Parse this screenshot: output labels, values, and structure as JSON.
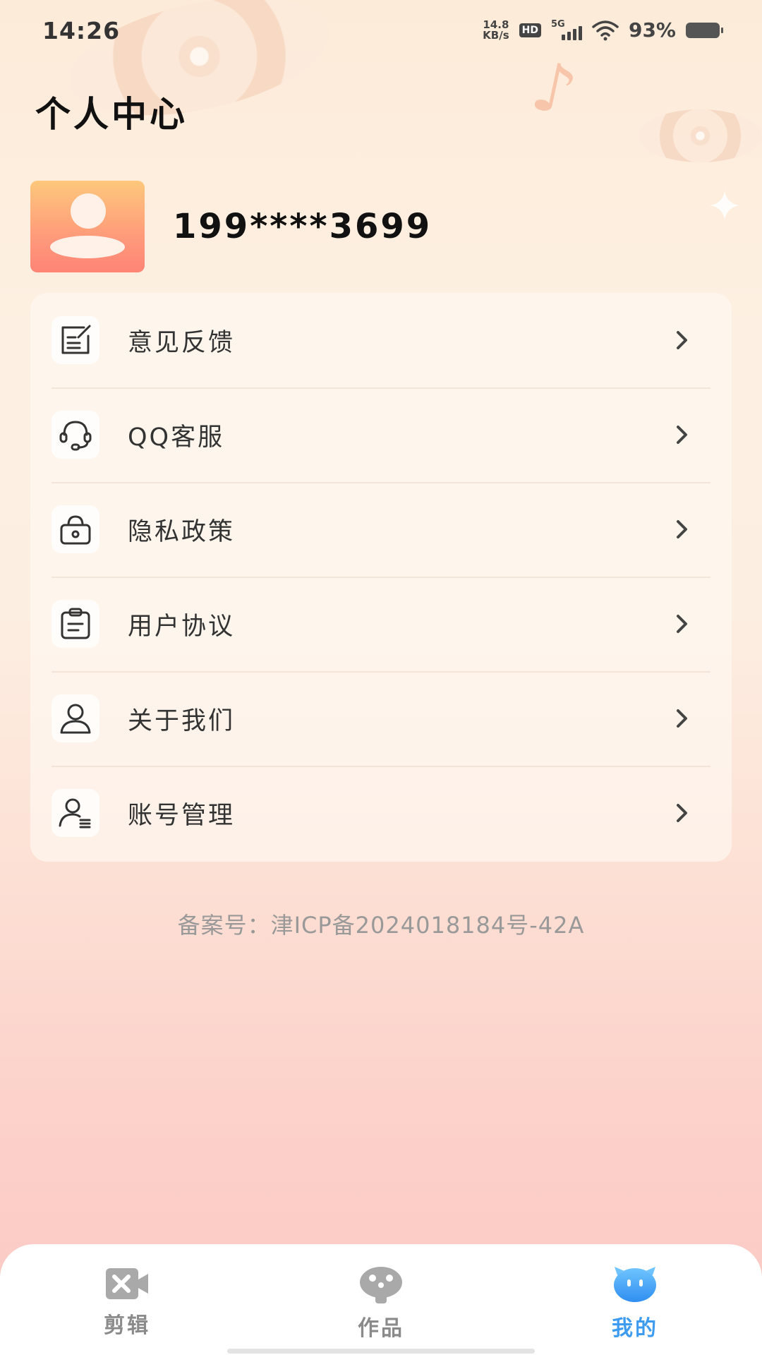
{
  "status_bar": {
    "time": "14:26",
    "net_speed_value": "14.8",
    "net_speed_unit": "KB/s",
    "hd_label": "HD",
    "network_type": "5G",
    "battery_percent": "93%"
  },
  "page": {
    "title": "个人中心"
  },
  "profile": {
    "username": "199****3699"
  },
  "menu": {
    "items": [
      {
        "label": "意见反馈",
        "icon": "feedback-icon"
      },
      {
        "label": "QQ客服",
        "icon": "headset-icon"
      },
      {
        "label": "隐私政策",
        "icon": "lock-icon"
      },
      {
        "label": "用户协议",
        "icon": "clipboard-icon"
      },
      {
        "label": "关于我们",
        "icon": "person-icon"
      },
      {
        "label": "账号管理",
        "icon": "account-manage-icon"
      }
    ]
  },
  "footer": {
    "icp": "备案号：津ICP备2024018184号-42A"
  },
  "tabbar": {
    "tabs": [
      {
        "label": "剪辑",
        "icon": "video-edit-icon",
        "active": false
      },
      {
        "label": "作品",
        "icon": "works-icon",
        "active": false
      },
      {
        "label": "我的",
        "icon": "mine-icon",
        "active": true
      }
    ]
  },
  "colors": {
    "accent": "#3d9cf0",
    "avatar_top": "#fdc87c",
    "avatar_bottom": "#fe8476"
  }
}
